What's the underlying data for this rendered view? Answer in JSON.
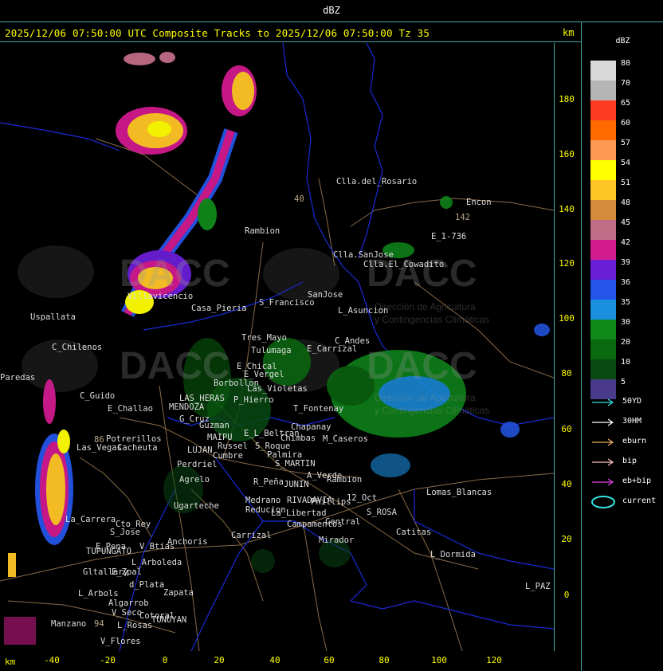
{
  "title": "dBZ",
  "header": {
    "text": "2025/12/06 07:50:00 UTC Composite Tracks to 2025/12/06 07:50:00 Tz 35",
    "km_label": "km"
  },
  "axes": {
    "y_ticks": [
      "180",
      "160",
      "140",
      "120",
      "100",
      "80",
      "60",
      "40",
      "20",
      "0"
    ],
    "x_ticks": [
      "-40",
      "-20",
      "0",
      "20",
      "40",
      "60",
      "80",
      "100",
      "120"
    ],
    "x_unit": "km"
  },
  "legend": {
    "title": "dBZ",
    "scale": [
      {
        "label": "80",
        "color": "#d9d9d9"
      },
      {
        "label": "70",
        "color": "#b5b5b5"
      },
      {
        "label": "65",
        "color": "#ff3a22"
      },
      {
        "label": "60",
        "color": "#ff6a00"
      },
      {
        "label": "57",
        "color": "#ff9a55"
      },
      {
        "label": "54",
        "color": "#ffff00"
      },
      {
        "label": "51",
        "color": "#ffc625"
      },
      {
        "label": "48",
        "color": "#d68a3c"
      },
      {
        "label": "45",
        "color": "#c06c86"
      },
      {
        "label": "42",
        "color": "#d01a8e"
      },
      {
        "label": "39",
        "color": "#6a1ed6"
      },
      {
        "label": "36",
        "color": "#2455e8"
      },
      {
        "label": "35",
        "color": "#1a8fe0"
      },
      {
        "label": "30",
        "color": "#0f8a1a"
      },
      {
        "label": "20",
        "color": "#0a6a10"
      },
      {
        "label": "10",
        "color": "#094a12"
      },
      {
        "label": "5",
        "color": "#4a3a8a"
      }
    ],
    "tracks": [
      {
        "label": "50YD",
        "color": "#33e0e0"
      },
      {
        "label": "30HM",
        "color": "#ffffff"
      },
      {
        "label": "eburn",
        "color": "#f0b060"
      },
      {
        "label": "bip",
        "color": "#ffc0c0"
      },
      {
        "label": "eb+bip",
        "color": "#e040e0"
      },
      {
        "label": "current",
        "color": "#33e0e0"
      }
    ]
  },
  "watermark": {
    "name": "DACC",
    "line1": "Dirección de Agricultura",
    "line2": "y Contingencias Climáticas"
  },
  "places": [
    {
      "name": "Clla.del_Rosario",
      "color": "#dddddd"
    },
    {
      "name": "Encon",
      "color": "#dddddd"
    },
    {
      "name": "E_1-736",
      "color": "#dddddd"
    },
    {
      "name": "Rambion",
      "color": "#dddddd"
    },
    {
      "name": "Clla.SanJose",
      "color": "#dddddd"
    },
    {
      "name": "Clla.El_Cowadito",
      "color": "#dddddd"
    },
    {
      "name": "SanJose",
      "color": "#dddddd"
    },
    {
      "name": "S_Francisco",
      "color": "#dddddd"
    },
    {
      "name": "L_Asuncion",
      "color": "#dddddd"
    },
    {
      "name": "Uspallata",
      "color": "#dddddd"
    },
    {
      "name": "Casa_Pieria",
      "color": "#dddddd"
    },
    {
      "name": "Villavicencio",
      "color": "#dddddd"
    },
    {
      "name": "Tres_Mayo",
      "color": "#dddddd"
    },
    {
      "name": "Tulumaga",
      "color": "#dddddd"
    },
    {
      "name": "C_Chilenos",
      "color": "#dddddd"
    },
    {
      "name": "E_Chical",
      "color": "#dddddd"
    },
    {
      "name": "E_Vergel",
      "color": "#dddddd"
    },
    {
      "name": "E_Carrizal",
      "color": "#dddddd"
    },
    {
      "name": "C_Andes",
      "color": "#dddddd"
    },
    {
      "name": "Paredas",
      "color": "#dddddd"
    },
    {
      "name": "C_Guido",
      "color": "#dddddd"
    },
    {
      "name": "E_Challao",
      "color": "#dddddd"
    },
    {
      "name": "Borbollon",
      "color": "#dddddd"
    },
    {
      "name": "LAS_HERAS",
      "color": "#dddddd"
    },
    {
      "name": "MENDOZA",
      "color": "#dddddd"
    },
    {
      "name": "P_Hierro",
      "color": "#dddddd"
    },
    {
      "name": "Las_Violetas",
      "color": "#dddddd"
    },
    {
      "name": "T_Fontenay",
      "color": "#dddddd"
    },
    {
      "name": "G_Cruz",
      "color": "#dddddd"
    },
    {
      "name": "Guzman",
      "color": "#dddddd"
    },
    {
      "name": "Chapanay",
      "color": "#dddddd"
    },
    {
      "name": "Potrerillos",
      "color": "#dddddd"
    },
    {
      "name": "Cacheuta",
      "color": "#dddddd"
    },
    {
      "name": "Las_Vegas",
      "color": "#dddddd"
    },
    {
      "name": "MAIPU",
      "color": "#dddddd"
    },
    {
      "name": "Russel",
      "color": "#dddddd"
    },
    {
      "name": "LUJAN",
      "color": "#dddddd"
    },
    {
      "name": "Cumbre",
      "color": "#dddddd"
    },
    {
      "name": "E_L_Beltran",
      "color": "#dddddd"
    },
    {
      "name": "S_Roque",
      "color": "#dddddd"
    },
    {
      "name": "Chimbas",
      "color": "#dddddd"
    },
    {
      "name": "M_Caseros",
      "color": "#dddddd"
    },
    {
      "name": "Palmira",
      "color": "#dddddd"
    },
    {
      "name": "Perdriel",
      "color": "#dddddd"
    },
    {
      "name": "S_MARTIN",
      "color": "#dddddd"
    },
    {
      "name": "A_Verde",
      "color": "#dddddd"
    },
    {
      "name": "Rambion",
      "color": "#dddddd"
    },
    {
      "name": "Agrelo",
      "color": "#dddddd"
    },
    {
      "name": "R_Peña",
      "color": "#dddddd"
    },
    {
      "name": "JUNIN",
      "color": "#dddddd"
    },
    {
      "name": "Lomas_Blancas",
      "color": "#dddddd"
    },
    {
      "name": "Medrano",
      "color": "#dddddd"
    },
    {
      "name": "RIVADAVIA",
      "color": "#dddddd"
    },
    {
      "name": "Phillips",
      "color": "#dddddd"
    },
    {
      "name": "12_Oct",
      "color": "#dddddd"
    },
    {
      "name": "Reducion",
      "color": "#dddddd"
    },
    {
      "name": "Ugarteche",
      "color": "#dddddd"
    },
    {
      "name": "S_ROSA",
      "color": "#dddddd"
    },
    {
      "name": "La_Libertad",
      "color": "#dddddd"
    },
    {
      "name": "Campamentos",
      "color": "#dddddd"
    },
    {
      "name": "Central",
      "color": "#dddddd"
    },
    {
      "name": "La_Carrera",
      "color": "#dddddd"
    },
    {
      "name": "Cto_Rey",
      "color": "#dddddd"
    },
    {
      "name": "S_Jose",
      "color": "#dddddd"
    },
    {
      "name": "Catitas",
      "color": "#dddddd"
    },
    {
      "name": "Anchoris",
      "color": "#dddddd"
    },
    {
      "name": "Carrizal",
      "color": "#dddddd"
    },
    {
      "name": "E_Pena",
      "color": "#dddddd"
    },
    {
      "name": "V_Btias",
      "color": "#dddddd"
    },
    {
      "name": "TUPUNGATO",
      "color": "#dddddd"
    },
    {
      "name": "Mirador",
      "color": "#dddddd"
    },
    {
      "name": "L_Dormida",
      "color": "#dddddd"
    },
    {
      "name": "L_Arboleda",
      "color": "#dddddd"
    },
    {
      "name": "E_Zpal",
      "color": "#dddddd"
    },
    {
      "name": "Gltallary",
      "color": "#dddddd"
    },
    {
      "name": "d_Plata",
      "color": "#dddddd"
    },
    {
      "name": "Zapata",
      "color": "#dddddd"
    },
    {
      "name": "L_Arbols",
      "color": "#dddddd"
    },
    {
      "name": "Algarrob",
      "color": "#dddddd"
    },
    {
      "name": "V_Seco",
      "color": "#dddddd"
    },
    {
      "name": "Cotoral",
      "color": "#dddddd"
    },
    {
      "name": "L_PAZ",
      "color": "#dddddd"
    },
    {
      "name": "Manzano",
      "color": "#dddddd"
    },
    {
      "name": "L_Rosas",
      "color": "#dddddd"
    },
    {
      "name": "TUNUYAN",
      "color": "#dddddd"
    },
    {
      "name": "V_Flores",
      "color": "#dddddd"
    },
    {
      "name": "142",
      "color": "#bba888"
    },
    {
      "name": "40",
      "color": "#bba888"
    },
    {
      "name": "86",
      "color": "#bba888"
    },
    {
      "name": "94",
      "color": "#bba888"
    }
  ]
}
